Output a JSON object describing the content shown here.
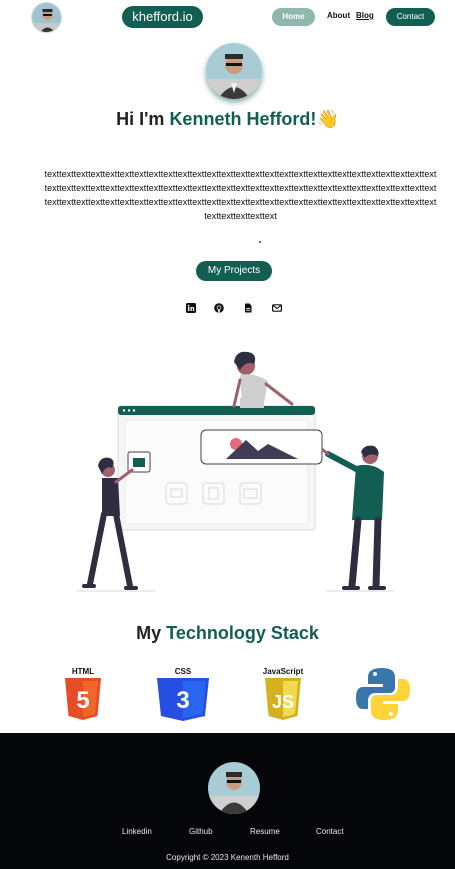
{
  "nav": {
    "brand": "khefford.io",
    "home": "Home",
    "about": "About",
    "blog": "Blog",
    "contact": "Contact"
  },
  "hero": {
    "greeting": "Hi I'm ",
    "name": "Kenneth Hefford!",
    "wave": "👋",
    "bio": "texttexttexttexttexttexttexttexttexttexttexttexttexttexttexttexttexttexttexttexttexttexttexttexttexttexttexttexttexttexttexttexttexttexttexttexttexttexttexttexttexttexttexttexttexttexttexttexttexttexttexttexttexttexttexttexttexttexttexttexttexttexttexttexttexttexttexttexttexttexttexttexttexttexttexttexttexttexttexttexttexttexttexttexttexttext",
    "projects_button": "My Projects"
  },
  "social_icons": [
    "linkedin-icon",
    "github-icon",
    "resume-file-icon",
    "email-icon"
  ],
  "tech": {
    "title_prefix": "My ",
    "title_accent": "Technology Stack",
    "items": [
      {
        "label": "HTML",
        "number": "5",
        "color": "#e44d26"
      },
      {
        "label": "CSS",
        "number": "3",
        "color": "#2965f1"
      },
      {
        "label": "JavaScript",
        "number": "JS",
        "color": "#e2c22b"
      },
      {
        "label": "",
        "icon": "python-logo-icon",
        "colors": [
          "#3776ab",
          "#ffd43b"
        ]
      }
    ]
  },
  "footer": {
    "links": [
      "Linkedin",
      "Github",
      "Resume",
      "Contact"
    ],
    "copyright": "Copyright © 2023 Kenenth Hefford"
  },
  "colors": {
    "accent": "#135e53",
    "home_pill": "#8fb7ad",
    "footer_bg": "#050608"
  }
}
